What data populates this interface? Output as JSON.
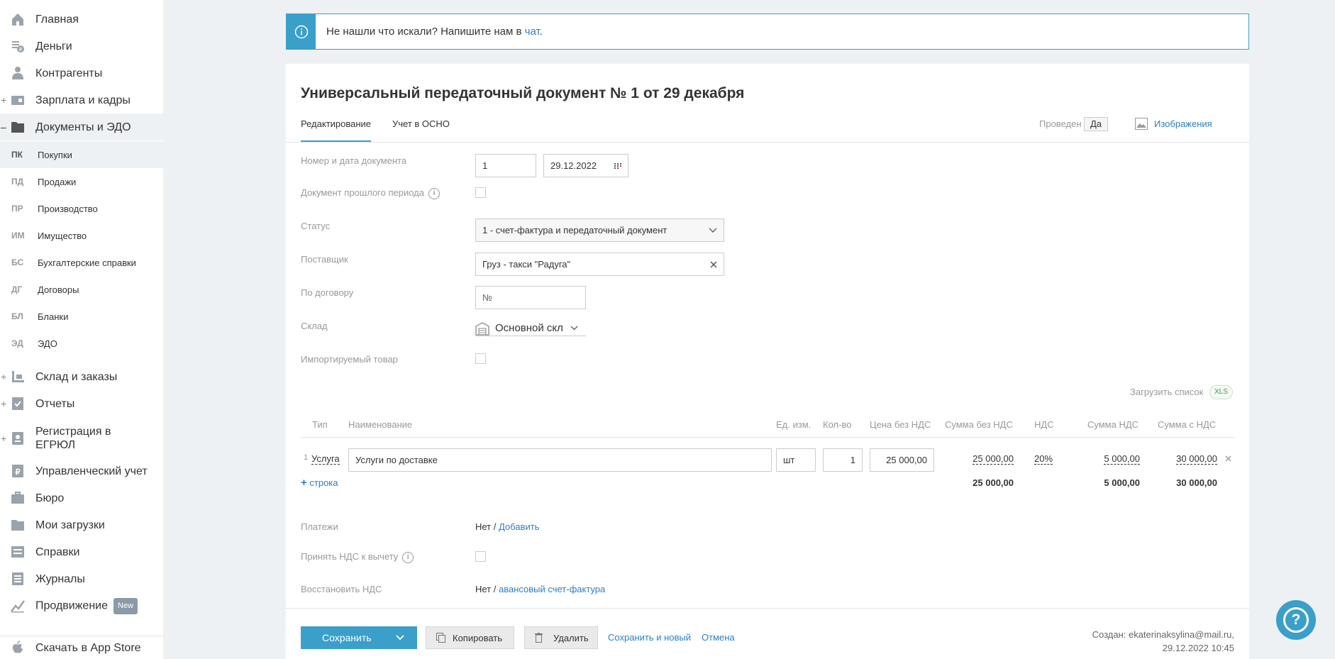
{
  "sidebar": {
    "items": [
      {
        "label": "Главная",
        "icon": "home-icon"
      },
      {
        "label": "Деньги",
        "icon": "money-icon"
      },
      {
        "label": "Контрагенты",
        "icon": "contractors-icon"
      },
      {
        "label": "Зарплата и кадры",
        "icon": "salary-icon",
        "expand": "+"
      },
      {
        "label": "Документы и ЭДО",
        "icon": "folder-icon",
        "expand": "–"
      },
      {
        "label": "Склад и заказы",
        "icon": "warehouse-icon",
        "expand": "+"
      },
      {
        "label": "Отчеты",
        "icon": "reports-icon",
        "expand": "+"
      },
      {
        "label": "Регистрация в ЕГРЮЛ",
        "icon": "registration-icon",
        "expand": "+"
      },
      {
        "label": "Управленческий учет",
        "icon": "management-icon"
      },
      {
        "label": "Бюро",
        "icon": "briefcase-icon"
      },
      {
        "label": "Мои загрузки",
        "icon": "uploads-icon"
      },
      {
        "label": "Справки",
        "icon": "certificates-icon"
      },
      {
        "label": "Журналы",
        "icon": "journals-icon"
      },
      {
        "label": "Продвижение",
        "icon": "promotion-icon",
        "badge": "New"
      },
      {
        "label": "Скачать в App Store",
        "icon": "apple-icon"
      }
    ],
    "subitems": [
      {
        "abbr": "ПК",
        "label": "Покупки"
      },
      {
        "abbr": "ПД",
        "label": "Продажи"
      },
      {
        "abbr": "ПР",
        "label": "Производство"
      },
      {
        "abbr": "ИМ",
        "label": "Имущество"
      },
      {
        "abbr": "БС",
        "label": "Бухгалтерские справки"
      },
      {
        "abbr": "ДГ",
        "label": "Договоры"
      },
      {
        "abbr": "БЛ",
        "label": "Бланки"
      },
      {
        "abbr": "ЭД",
        "label": "ЭДО"
      }
    ]
  },
  "banner": {
    "text": "Не нашли что искали? Напишите нам в ",
    "link": "чат",
    "end": "."
  },
  "doc": {
    "title": "Универсальный передаточный документ № 1 от 29 декабря",
    "tabs": [
      "Редактирование",
      "Учет в ОСНО"
    ],
    "posted_label": "Проведен",
    "posted_value": "Да",
    "images_label": "Изображения"
  },
  "form": {
    "number_label": "Номер и дата документа",
    "number": "1",
    "date": "29.12.2022",
    "past_period_label": "Документ прошлого периода",
    "status_label": "Статус",
    "status": "1 - счет-фактура и передаточный документ",
    "supplier_label": "Поставщик",
    "supplier": "Груз - такси \"Радуга\"",
    "contract_label": "По договору",
    "contract_placeholder": "№",
    "warehouse_label": "Склад",
    "warehouse": "Основной скл",
    "imported_label": "Импортируемый товар",
    "upload_list": "Загрузить список",
    "xls": "XLS"
  },
  "table": {
    "headers": [
      "Тип",
      "Наименование",
      "Ед. изм.",
      "Кол-во",
      "Цена без НДС",
      "Сумма без НДС",
      "НДС",
      "Сумма НДС",
      "Сумма с НДС"
    ],
    "row": {
      "n": "1",
      "type": "Услуга",
      "name": "Услуги по доставке",
      "unit": "шт",
      "qty": "1",
      "price": "25 000,00",
      "sum": "25 000,00",
      "vat": "20%",
      "vat_sum": "5 000,00",
      "total": "30 000,00"
    },
    "add_row": "строка",
    "totals": {
      "sum": "25 000,00",
      "vat_sum": "5 000,00",
      "total": "30 000,00"
    }
  },
  "bottom": {
    "payments_label": "Платежи",
    "payments_value": "Нет",
    "payments_add": "Добавить",
    "accept_vat_label": "Принять НДС к вычету",
    "restore_vat_label": "Восстановить НДС",
    "restore_vat_value": "Нет",
    "restore_vat_link": "авансовый счет-фактура"
  },
  "footer": {
    "save": "Сохранить",
    "copy": "Копировать",
    "delete": "Удалить",
    "save_new": "Сохранить и новый",
    "cancel": "Отмена",
    "created": "Создан: ekaterinaksylina@mail.ru,",
    "created_date": "29.12.2022 10:45"
  },
  "help_symbol": "?",
  "colors": {
    "accent": "#3a9fc9",
    "link": "#2d7fc1"
  }
}
